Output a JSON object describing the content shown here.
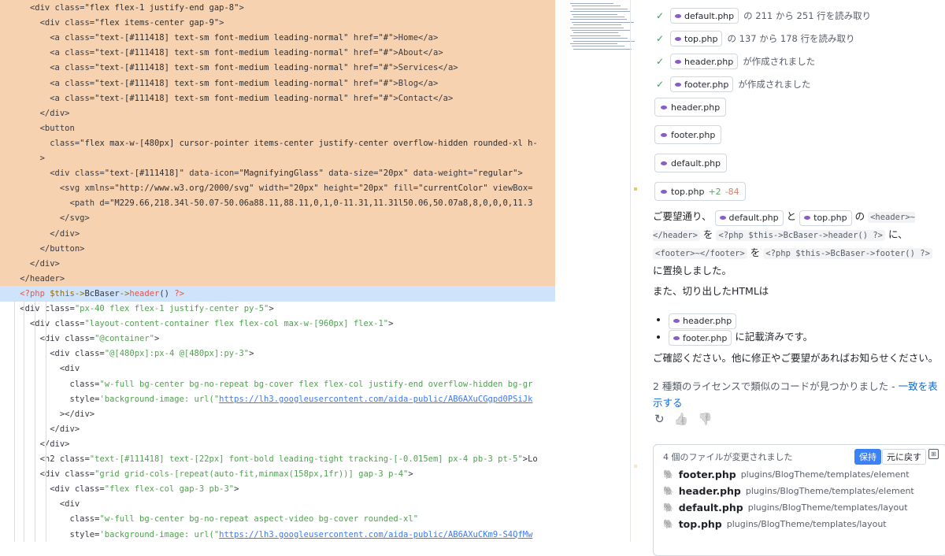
{
  "editor": {
    "lines": [
      {
        "kind": "del",
        "segs": [
          [
            "      ",
            "t"
          ],
          [
            "<div class=",
            "t"
          ],
          [
            "\"flex flex-1 justify-end gap-8\"",
            "s"
          ],
          [
            ">",
            "t"
          ]
        ]
      },
      {
        "kind": "del",
        "segs": [
          [
            "        <div class=",
            "t"
          ],
          [
            "\"flex items-center gap-9\"",
            "s"
          ],
          [
            ">",
            "t"
          ]
        ]
      },
      {
        "kind": "del",
        "segs": [
          [
            "          <a class=",
            "t"
          ],
          [
            "\"text-[#111418] text-sm font-medium leading-normal\"",
            "s"
          ],
          [
            " href=",
            "t"
          ],
          [
            "\"#\"",
            "s"
          ],
          [
            ">Home</a>",
            "t"
          ]
        ]
      },
      {
        "kind": "del",
        "segs": [
          [
            "          <a class=",
            "t"
          ],
          [
            "\"text-[#111418] text-sm font-medium leading-normal\"",
            "s"
          ],
          [
            " href=",
            "t"
          ],
          [
            "\"#\"",
            "s"
          ],
          [
            ">About</a>",
            "t"
          ]
        ]
      },
      {
        "kind": "del",
        "segs": [
          [
            "          <a class=",
            "t"
          ],
          [
            "\"text-[#111418] text-sm font-medium leading-normal\"",
            "s"
          ],
          [
            " href=",
            "t"
          ],
          [
            "\"#\"",
            "s"
          ],
          [
            ">Services</a>",
            "t"
          ]
        ]
      },
      {
        "kind": "del",
        "segs": [
          [
            "          <a class=",
            "t"
          ],
          [
            "\"text-[#111418] text-sm font-medium leading-normal\"",
            "s"
          ],
          [
            " href=",
            "t"
          ],
          [
            "\"#\"",
            "s"
          ],
          [
            ">Blog</a>",
            "t"
          ]
        ]
      },
      {
        "kind": "del",
        "segs": [
          [
            "          <a class=",
            "t"
          ],
          [
            "\"text-[#111418] text-sm font-medium leading-normal\"",
            "s"
          ],
          [
            " href=",
            "t"
          ],
          [
            "\"#\"",
            "s"
          ],
          [
            ">Contact</a>",
            "t"
          ]
        ]
      },
      {
        "kind": "del",
        "segs": [
          [
            "        </div>",
            "t"
          ]
        ]
      },
      {
        "kind": "del",
        "segs": [
          [
            "        <button",
            "t"
          ]
        ]
      },
      {
        "kind": "del",
        "segs": [
          [
            "          class=",
            "t"
          ],
          [
            "\"flex max-w-[480px] cursor-pointer items-center justify-center overflow-hidden rounded-xl h-",
            "s"
          ]
        ]
      },
      {
        "kind": "del",
        "segs": [
          [
            "        >",
            "t"
          ]
        ]
      },
      {
        "kind": "del",
        "segs": [
          [
            "          <div class=",
            "t"
          ],
          [
            "\"text-[#111418]\"",
            "s"
          ],
          [
            " data-icon=",
            "t"
          ],
          [
            "\"MagnifyingGlass\"",
            "s"
          ],
          [
            " data-size=",
            "t"
          ],
          [
            "\"20px\"",
            "s"
          ],
          [
            " data-weight=",
            "t"
          ],
          [
            "\"regular\"",
            "s"
          ],
          [
            ">",
            "t"
          ]
        ]
      },
      {
        "kind": "del",
        "segs": [
          [
            "            <svg xmlns=",
            "t"
          ],
          [
            "\"http://www.w3.org/2000/svg\"",
            "s"
          ],
          [
            " width=",
            "t"
          ],
          [
            "\"20px\"",
            "s"
          ],
          [
            " height=",
            "t"
          ],
          [
            "\"20px\"",
            "s"
          ],
          [
            " fill=",
            "t"
          ],
          [
            "\"currentColor\"",
            "s"
          ],
          [
            " viewBox=",
            "t"
          ]
        ]
      },
      {
        "kind": "del",
        "segs": [
          [
            "              <path d=",
            "t"
          ],
          [
            "\"M229.66,218.34l-50.07-50.06a88.11,88.11,0,1,0-11.31,11.31l50.06,50.07a8,8,0,0,0,11.3",
            "s"
          ]
        ]
      },
      {
        "kind": "del",
        "segs": [
          [
            "            </svg>",
            "t"
          ]
        ]
      },
      {
        "kind": "del",
        "segs": [
          [
            "          </div>",
            "t"
          ]
        ]
      },
      {
        "kind": "del",
        "segs": [
          [
            "        </button>",
            "t"
          ]
        ]
      },
      {
        "kind": "del",
        "segs": [
          [
            "      </div>",
            "t"
          ]
        ]
      },
      {
        "kind": "del",
        "segs": [
          [
            "    </header>",
            "t"
          ]
        ]
      },
      {
        "kind": "add",
        "segs": [
          [
            "    ",
            "t"
          ],
          [
            "<?php",
            "p"
          ],
          [
            " $this->",
            "v"
          ],
          [
            "BcBaser",
            "t"
          ],
          [
            "->",
            "v"
          ],
          [
            "header",
            "p"
          ],
          [
            "() ",
            "t"
          ],
          [
            "?>",
            "p"
          ]
        ]
      },
      {
        "kind": "ctx",
        "segs": [
          [
            "    <div class=",
            "t"
          ],
          [
            "\"px-40 flex flex-1 justify-center py-5\"",
            "s"
          ],
          [
            ">",
            "t"
          ]
        ]
      },
      {
        "kind": "ctx",
        "segs": [
          [
            "      <div class=",
            "t"
          ],
          [
            "\"layout-content-container flex flex-col max-w-[960px] flex-1\"",
            "s"
          ],
          [
            ">",
            "t"
          ]
        ]
      },
      {
        "kind": "ctx",
        "segs": [
          [
            "        <div class=",
            "t"
          ],
          [
            "\"@container\"",
            "s"
          ],
          [
            ">",
            "t"
          ]
        ]
      },
      {
        "kind": "ctx",
        "segs": [
          [
            "          <div class=",
            "t"
          ],
          [
            "\"@[480px]:px-4 @[480px]:py-3\"",
            "s"
          ],
          [
            ">",
            "t"
          ]
        ]
      },
      {
        "kind": "ctx",
        "segs": [
          [
            "            <div",
            "t"
          ]
        ]
      },
      {
        "kind": "ctx",
        "segs": [
          [
            "              class=",
            "t"
          ],
          [
            "\"w-full bg-center bg-no-repeat bg-cover flex flex-col justify-end overflow-hidden bg-gr",
            "s"
          ]
        ]
      },
      {
        "kind": "ctx",
        "segs": [
          [
            "              style=",
            "t"
          ],
          [
            "'background-image: url(\"",
            "s"
          ],
          [
            "https://lh3.googleusercontent.com/aida-public/AB6AXuCGgpd0PSiJk",
            "u"
          ]
        ]
      },
      {
        "kind": "ctx",
        "segs": [
          [
            "            ></div>",
            "t"
          ]
        ]
      },
      {
        "kind": "ctx",
        "segs": [
          [
            "          </div>",
            "t"
          ]
        ]
      },
      {
        "kind": "ctx",
        "segs": [
          [
            "        </div>",
            "t"
          ]
        ]
      },
      {
        "kind": "ctx",
        "segs": [
          [
            "        <h2 class=",
            "t"
          ],
          [
            "\"text-[#111418] text-[22px] font-bold leading-tight tracking-[-0.015em] px-4 pb-3 pt-5\"",
            "s"
          ],
          [
            ">Lo",
            "t"
          ]
        ]
      },
      {
        "kind": "ctx",
        "segs": [
          [
            "        <div class=",
            "t"
          ],
          [
            "\"grid grid-cols-[repeat(auto-fit,minmax(158px,1fr))] gap-3 p-4\"",
            "s"
          ],
          [
            ">",
            "t"
          ]
        ]
      },
      {
        "kind": "ctx",
        "segs": [
          [
            "          <div class=",
            "t"
          ],
          [
            "\"flex flex-col gap-3 pb-3\"",
            "s"
          ],
          [
            ">",
            "t"
          ]
        ]
      },
      {
        "kind": "ctx",
        "segs": [
          [
            "            <div",
            "t"
          ]
        ]
      },
      {
        "kind": "ctx",
        "segs": [
          [
            "              class=",
            "t"
          ],
          [
            "\"w-full bg-center bg-no-repeat aspect-video bg-cover rounded-xl\"",
            "s"
          ]
        ]
      },
      {
        "kind": "ctx",
        "segs": [
          [
            "              style=",
            "t"
          ],
          [
            "'background-image: url(\"",
            "s"
          ],
          [
            "https://lh3.googleusercontent.com/aida-public/AB6AXuCKm9-S4QfMw",
            "u"
          ]
        ]
      }
    ]
  },
  "chat": {
    "activities": [
      {
        "file": "default.php",
        "text": "の 211 から 251 行を読み取り"
      },
      {
        "file": "top.php",
        "text": "の 137 から 178 行を読み取り"
      },
      {
        "file": "header.php",
        "text": "が作成されました"
      },
      {
        "file": "footer.php",
        "text": "が作成されました"
      }
    ],
    "blocks": [
      {
        "file": "header.php",
        "plus": "",
        "minus": ""
      },
      {
        "file": "footer.php",
        "plus": "",
        "minus": ""
      },
      {
        "file": "default.php",
        "plus": "",
        "minus": ""
      },
      {
        "file": "top.php",
        "plus": "+2",
        "minus": "-84"
      }
    ],
    "msg1": {
      "a": "ご要望通り、",
      "f1": "default.php",
      "b": "と",
      "f2": "top.php",
      "c": "の",
      "code1": "<header>~</header>",
      "d": "を",
      "code2": "<?php $this->BcBaser->header() ?>",
      "e": "に、",
      "code3": "<footer>~</footer>",
      "f": "を",
      "code4": "<?php $this->BcBaser->footer() ?>",
      "g": "に置換しました。"
    },
    "msg2": "また、切り出したHTMLは",
    "bullets": {
      "f1": "header.php",
      "f2": "footer.php",
      "suffix": "に記載済みです。"
    },
    "msg3": "ご確認ください。他に修正やご要望があればお知らせください。",
    "license": {
      "text": "2 種類のライセンスで類似のコードが見つかりました - ",
      "link": "一致を表示する"
    },
    "feedback": {
      "retry": "↻",
      "up": "👍",
      "down": "👎"
    },
    "changes": {
      "header": "4 個のファイルが変更されました",
      "keep": "保持",
      "undo": "元に戻す",
      "open": "⊞",
      "files": [
        {
          "name": "footer.php",
          "path": "plugins/BlogTheme/templates/element"
        },
        {
          "name": "header.php",
          "path": "plugins/BlogTheme/templates/element"
        },
        {
          "name": "default.php",
          "path": "plugins/BlogTheme/templates/layout"
        },
        {
          "name": "top.php",
          "path": "plugins/BlogTheme/templates/layout"
        }
      ]
    }
  },
  "colors": {
    "deleted": "#f6d2b1",
    "added": "#cfe3fb",
    "accent": "#3b82f6",
    "link": "#0969da",
    "check": "#2da44e"
  }
}
